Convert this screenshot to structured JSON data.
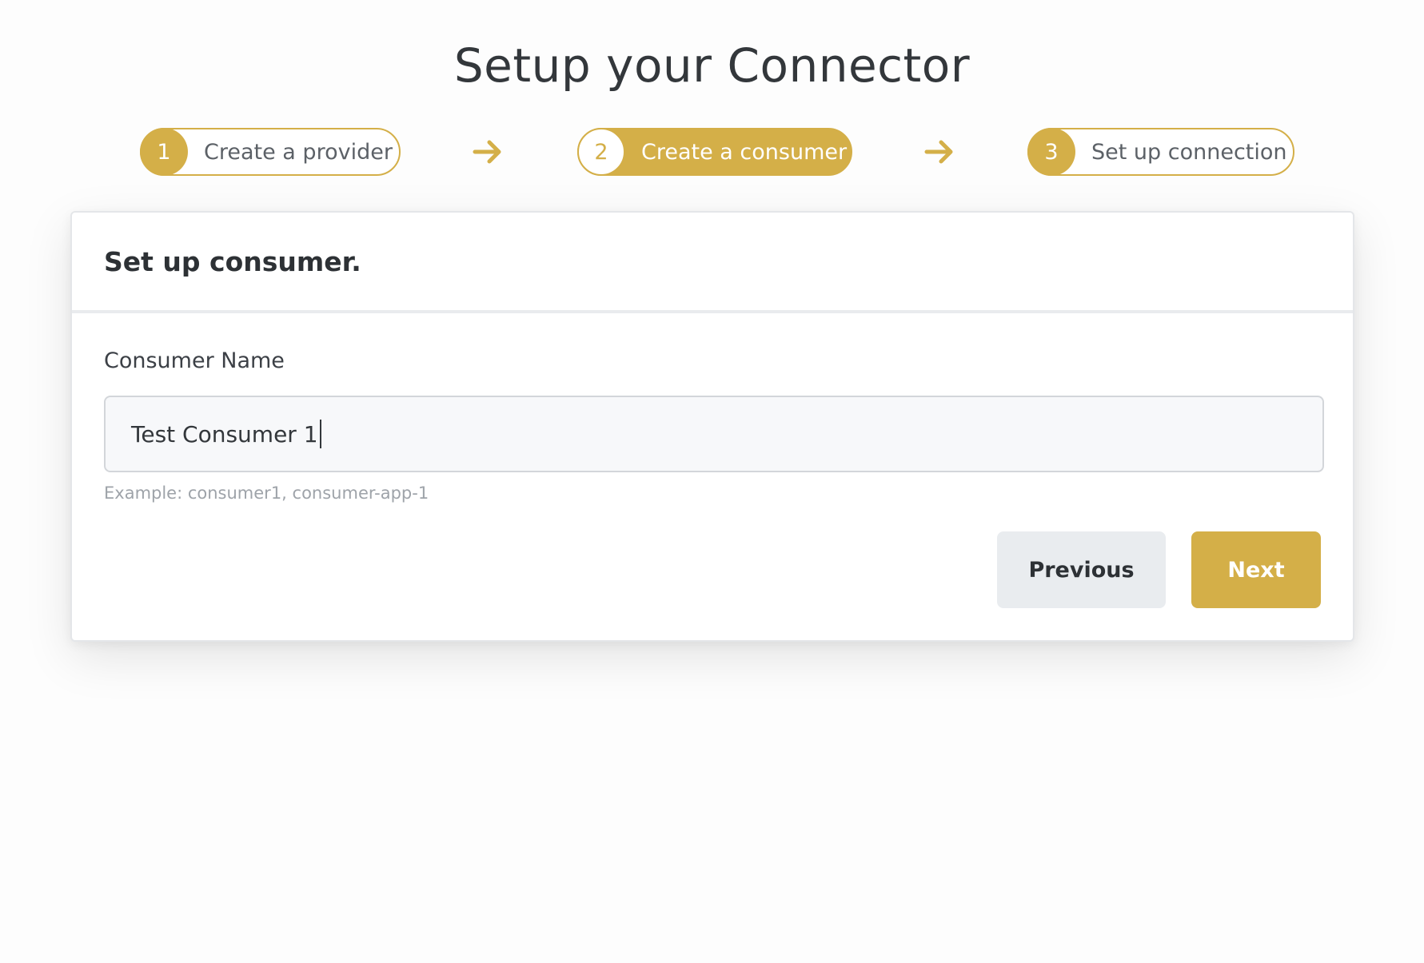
{
  "page": {
    "title": "Setup your Connector"
  },
  "stepper": {
    "steps": [
      {
        "number": "1",
        "label": "Create a provider",
        "state": "inactive"
      },
      {
        "number": "2",
        "label": "Create a consumer",
        "state": "active"
      },
      {
        "number": "3",
        "label": "Set up connection",
        "state": "inactive"
      }
    ],
    "arrow_icon": "arrow-right-icon"
  },
  "card": {
    "header_title": "Set up consumer.",
    "form": {
      "consumer_name_label": "Consumer Name",
      "consumer_name_value": "Test Consumer 1",
      "consumer_name_help": "Example: consumer1, consumer-app-1"
    },
    "buttons": {
      "previous_label": "Previous",
      "next_label": "Next"
    }
  },
  "colors": {
    "accent": "#d4af48",
    "text": "#33373b",
    "muted": "#9ea3a9",
    "secondary_button_bg": "#e9ecef",
    "input_bg": "#f7f8fa"
  }
}
